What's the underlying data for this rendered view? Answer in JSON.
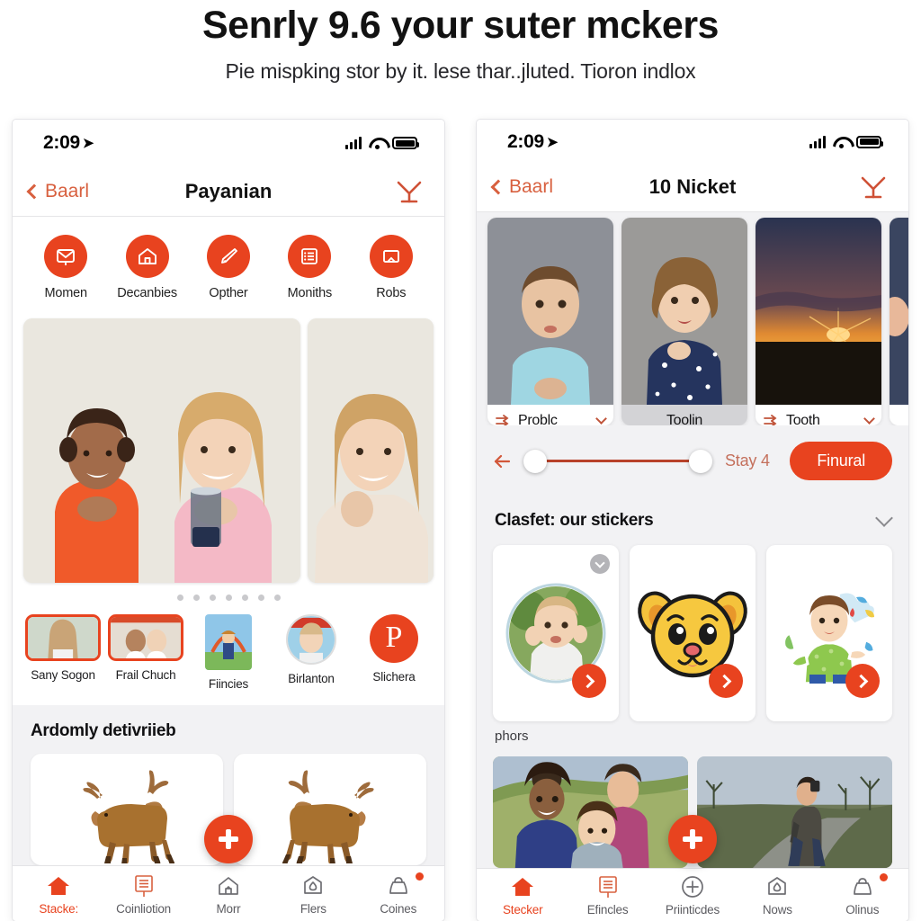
{
  "hero": {
    "title": "Senrly 9.6 your suter mckers",
    "subtitle": "Pie mispking stor by it. lese thar..jluted. Tioron indlox"
  },
  "colors": {
    "accent": "#e8431f",
    "accent_soft": "#d8603f",
    "panel_bg": "#f2f2f4",
    "card_bg": "#ffffff",
    "text": "#111111",
    "muted_text": "#5c5c61"
  },
  "left_phone": {
    "status": {
      "time": "2:09",
      "location_icon": "location-arrow-icon",
      "signal_icon": "cellular-bars-icon",
      "wifi_icon": "wifi-icon",
      "battery_icon": "battery-icon"
    },
    "nav": {
      "back_label": "Baarl",
      "title": "Payanian",
      "action_icon": "filter-funnel-icon"
    },
    "categories": [
      {
        "label": "Momen",
        "icon": "envelope-icon"
      },
      {
        "label": "Decanbies",
        "icon": "home-icon"
      },
      {
        "label": "Opther",
        "icon": "brush-icon"
      },
      {
        "label": "Moniths",
        "icon": "list-icon"
      },
      {
        "label": "Robs",
        "icon": "frame-icon"
      }
    ],
    "carousel": {
      "dots": 7,
      "active_dot": 0
    },
    "stories": [
      {
        "label": "Sany Sogon",
        "style": "ring"
      },
      {
        "label": "Frail Chuch",
        "style": "ring"
      },
      {
        "label": "Fiincies",
        "style": "tall"
      },
      {
        "label": "Birlanton",
        "style": "round"
      },
      {
        "label": "Slichera",
        "style": "brand",
        "glyph": "P"
      }
    ],
    "section_title": "Ardomly detivriieb",
    "deer_cards": 2,
    "fab_icon": "plus-icon",
    "tabs": [
      {
        "label": "Stacke:",
        "icon": "home-icon",
        "active": true,
        "badge": false
      },
      {
        "label": "Coinliotion",
        "icon": "lines-card-icon",
        "active": false,
        "badge": false
      },
      {
        "label": "Morr",
        "icon": "house-outline-icon",
        "active": false,
        "badge": false
      },
      {
        "label": "Flers",
        "icon": "shield-drop-icon",
        "active": false,
        "badge": false
      },
      {
        "label": "Coines",
        "icon": "purse-icon",
        "active": false,
        "badge": true
      }
    ]
  },
  "right_phone": {
    "status": {
      "time": "2:09",
      "location_icon": "location-arrow-icon",
      "signal_icon": "cellular-bars-icon",
      "wifi_icon": "wifi-icon",
      "battery_icon": "battery-icon"
    },
    "nav": {
      "back_label": "Baarl",
      "title": "10 Nicket",
      "action_icon": "filter-funnel-icon"
    },
    "photo_cards": [
      {
        "label": "Problc",
        "has_arrows": true,
        "has_chevron": true,
        "muted": false
      },
      {
        "label": "Toolin",
        "has_arrows": false,
        "has_chevron": false,
        "muted": true
      },
      {
        "label": "Tooth",
        "has_arrows": true,
        "has_chevron": true,
        "muted": false
      }
    ],
    "slider": {
      "back_icon": "arrow-left-icon",
      "stay_label": "Stay 4",
      "action_label": "Finural"
    },
    "stickers_header": {
      "title": "Clasfet: our stickers",
      "chevron": "chevron-down-icon"
    },
    "stickers": [
      {
        "kind": "baby-photo-sticker",
        "selected": true,
        "go_icon": "chevron-right-icon"
      },
      {
        "kind": "dog-face-sticker",
        "selected": false,
        "go_icon": "chevron-right-icon"
      },
      {
        "kind": "kid-painting-sticker",
        "selected": false,
        "go_icon": "chevron-right-icon"
      }
    ],
    "photos_label": "phors",
    "bottom_photos": 2,
    "fab_icon": "plus-icon",
    "tabs": [
      {
        "label": "Stecker",
        "icon": "home-icon",
        "active": true,
        "badge": false
      },
      {
        "label": "Efincles",
        "icon": "lines-card-icon",
        "active": false,
        "badge": false
      },
      {
        "label": "Priinticdes",
        "icon": "plus-circle-icon",
        "active": false,
        "badge": false
      },
      {
        "label": "Nows",
        "icon": "shield-drop-icon",
        "active": false,
        "badge": false
      },
      {
        "label": "Olinus",
        "icon": "purse-icon",
        "active": false,
        "badge": true
      }
    ]
  }
}
